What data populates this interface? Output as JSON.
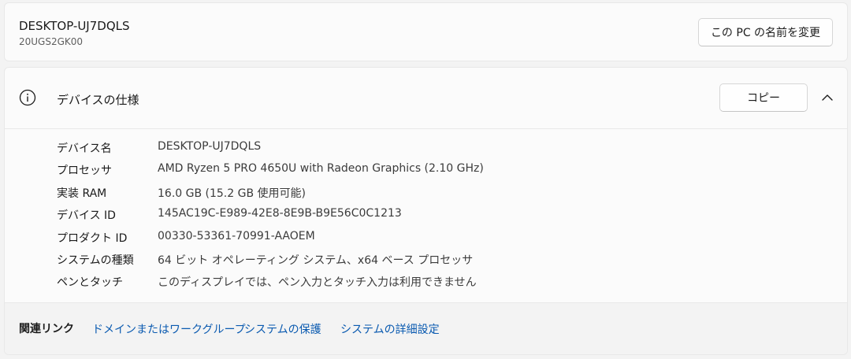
{
  "device": {
    "name": "DESKTOP-UJ7DQLS",
    "model": "20UGS2GK00",
    "rename_button": "この PC の名前を変更"
  },
  "spec": {
    "title": "デバイスの仕様",
    "copy_button": "コピー",
    "icons": {
      "info": "info-icon",
      "chevron": "chevron-up-icon"
    },
    "rows": [
      {
        "label": "デバイス名",
        "value": "DESKTOP-UJ7DQLS"
      },
      {
        "label": "プロセッサ",
        "value": "AMD Ryzen 5 PRO 4650U with Radeon Graphics (2.10 GHz)"
      },
      {
        "label": "実装 RAM",
        "value": "16.0 GB (15.2 GB 使用可能)"
      },
      {
        "label": "デバイス ID",
        "value": "145AC19C-E989-42E8-8E9B-B9E56C0C1213"
      },
      {
        "label": "プロダクト ID",
        "value": "00330-53361-70991-AAOEM"
      },
      {
        "label": "システムの種類",
        "value": "64 ビット オペレーティング システム、x64 ベース プロセッサ"
      },
      {
        "label": "ペンとタッチ",
        "value": "このディスプレイでは、ペン入力とタッチ入力は利用できません"
      }
    ]
  },
  "related": {
    "title": "関連リンク",
    "links": [
      "ドメインまたはワークグループ",
      "システムの保護",
      "システムの詳細設定"
    ]
  },
  "colors": {
    "link": "#0a5ab0",
    "card": "#fbfbfb",
    "background": "#f3f3f3"
  }
}
